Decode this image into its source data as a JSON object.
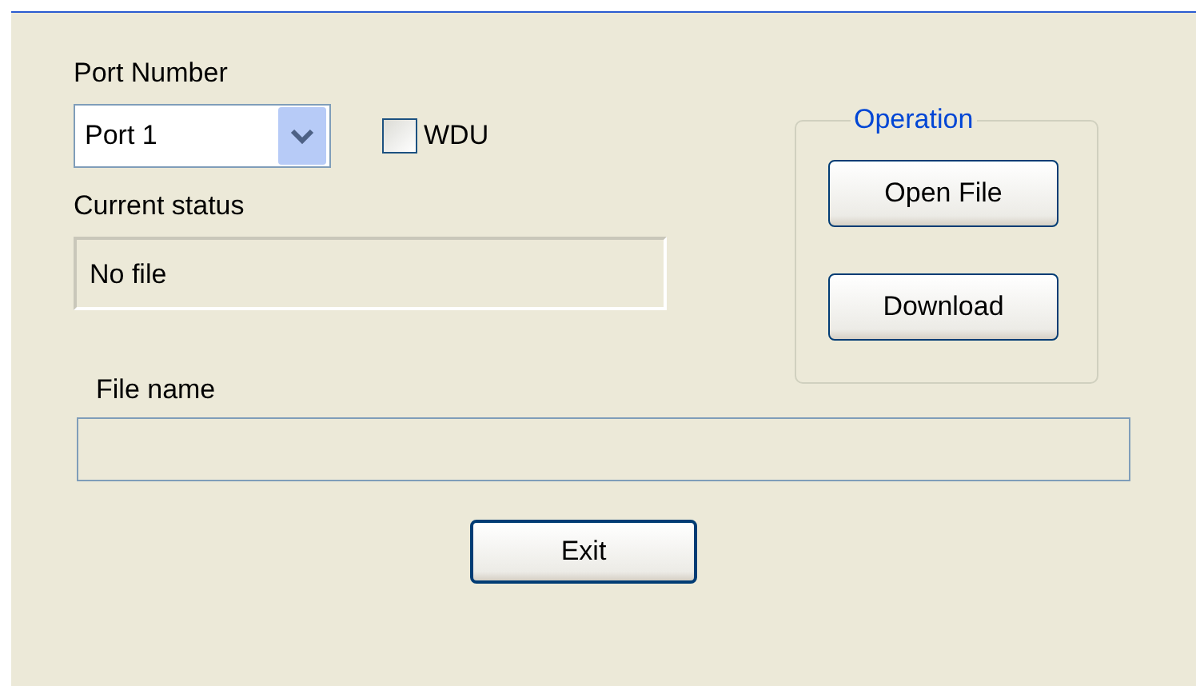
{
  "port_number": {
    "label": "Port Number",
    "value": "Port 1"
  },
  "wdu": {
    "label": "WDU",
    "checked": false
  },
  "current_status": {
    "label": "Current status",
    "value": "No file"
  },
  "operation": {
    "title": "Operation",
    "buttons": [
      "Open File",
      "Download"
    ]
  },
  "file_name": {
    "label": "File name"
  },
  "exit_button": "Exit"
}
